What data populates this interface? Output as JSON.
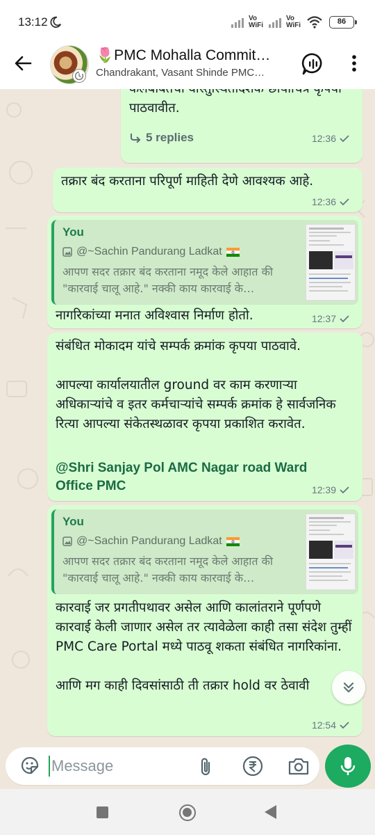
{
  "status_bar": {
    "time": "13:12",
    "network_1": "Vo\nWiFi",
    "network_2": "Vo\nWiFi",
    "battery": "86"
  },
  "header": {
    "title": "🌷PMC Mohalla Commit…",
    "subtitle": "Chandrakant, Vasant Shinde PMC…"
  },
  "messages": [
    {
      "text": "केलेबाबतची वास्तुस्थितीदर्शक छायाचित्रे कृपया पाठवावीत.",
      "replies": "5 replies",
      "time": "12:36"
    },
    {
      "text": "तक्रार बंद करताना परिपूर्ण माहिती देणे आवश्यक आहे.",
      "time": "12:36"
    },
    {
      "quote_author": "You",
      "quote_sender": "@~Sachin Pandurang Ladkat",
      "quote_text": "आपण सदर तक्रार बंद करताना नमूद केले आहात की \"कारवाई चालू आहे.\" नक्की काय कारवाई के…",
      "text": "नागरिकांच्या मनात अविश्वास निर्माण होतो.",
      "time": "12:37"
    },
    {
      "text": "संबंधित मोकादम यांचे सम्पर्क क्रमांक कृपया पाठवावे.\n\nआपल्या कार्यालयातील ground वर काम करणाऱ्या अधिकाऱ्यांचे व इतर कर्मचाऱ्यांचे सम्पर्क क्रमांक हे सार्वजनिक रित्या आपल्या संकेतस्थळावर कृपया प्रकाशित करावेत.",
      "mention": "@Shri Sanjay Pol AMC Nagar road Ward Office PMC",
      "time": "12:39"
    },
    {
      "quote_author": "You",
      "quote_sender": "@~Sachin Pandurang Ladkat",
      "quote_text": "आपण सदर तक्रार बंद करताना नमूद केले आहात की \"कारवाई चालू आहे.\" नक्की काय कारवाई के…",
      "text": "कारवाई जर प्रगतीपथावर असेल आणि कालांतराने पूर्णपणे कारवाई केली जाणार असेल तर त्यावेळेला काही तसा संदेश तुम्हीं PMC Care Portal मध्ये पाठवू शकता संबंधित नागरिकांना.\n\nआणि मग काही दिवसांसाठी ती तक्रार hold वर ठेवावी",
      "time": "12:54"
    }
  ],
  "composer": {
    "placeholder": "Message"
  },
  "colors": {
    "bubble": "#d9fdd3",
    "accent": "#1daa61",
    "chat_bg": "#efe7dc",
    "mention": "#1a6b45"
  }
}
